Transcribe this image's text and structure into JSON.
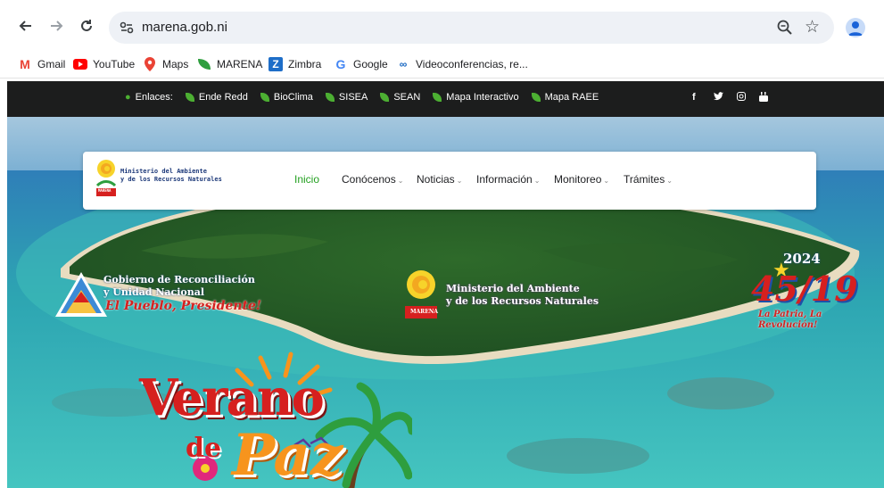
{
  "browser": {
    "url": "marena.gob.ni",
    "bookmarks": [
      "Gmail",
      "YouTube",
      "Maps",
      "MARENA",
      "Zimbra",
      "Google",
      "Videoconferencias, re..."
    ]
  },
  "site": {
    "links_label": "Enlaces:",
    "links": [
      "Ende Redd",
      "BioClima",
      "SISEA",
      "SEAN",
      "Mapa Interactivo",
      "Mapa RAEE"
    ],
    "social": [
      "f",
      "y",
      "o",
      "yt"
    ],
    "logo_line1": "Ministerio del Ambiente",
    "logo_line2": "y de los Recursos Naturales",
    "logo_badge": "MARENA",
    "menu": [
      {
        "label": "Inicio",
        "active": true
      },
      {
        "label": "Conócenos",
        "active": false
      },
      {
        "label": "Noticias",
        "active": false
      },
      {
        "label": "Información",
        "active": false
      },
      {
        "label": "Monitoreo",
        "active": false
      },
      {
        "label": "Trámites",
        "active": false
      }
    ]
  },
  "hero": {
    "gov_line1": "Gobierno de Reconciliación",
    "gov_line2": "y Unidad Nacional",
    "gov_slogan": "El Pueblo, Presidente!",
    "ministry_line1": "Ministerio del Ambiente",
    "ministry_line2": "y de los Recursos Naturales",
    "ministry_badge": "MARENA",
    "year": "2024",
    "anniv": "45/19",
    "anniv_slogan": "La Patria, La Revolución!",
    "banner_word1": "Verano",
    "banner_word2": "de",
    "banner_word3": "Paz"
  },
  "colors": {
    "brand_green": "#24a021",
    "topbar": "#1c1d1d",
    "banner_red": "#d6201f",
    "banner_orange": "#f7941d"
  }
}
